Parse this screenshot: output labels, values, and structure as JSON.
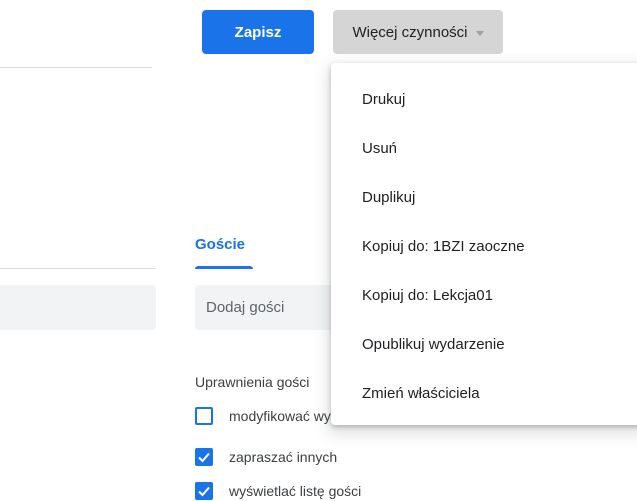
{
  "toolbar": {
    "save_label": "Zapisz",
    "more_actions_label": "Więcej czynności"
  },
  "menu": {
    "items": [
      {
        "label": "Drukuj"
      },
      {
        "label": "Usuń"
      },
      {
        "label": "Duplikuj"
      },
      {
        "label": "Kopiuj do: 1BZI zaoczne"
      },
      {
        "label": "Kopiuj do: Lekcja01"
      },
      {
        "label": "Opublikuj wydarzenie"
      },
      {
        "label": "Zmień właściciela"
      }
    ]
  },
  "guests": {
    "tab_label": "Goście",
    "add_placeholder": "Dodaj gości",
    "permissions_label": "Uprawnienia gości",
    "permissions": [
      {
        "label": "modyfikować wydarzenie",
        "checked": false
      },
      {
        "label": "zapraszać innych",
        "checked": true
      },
      {
        "label": "wyświetlać listę gości",
        "checked": true
      }
    ]
  },
  "colors": {
    "accent": "#1a73e8",
    "secondary_button_bg": "#d5d5d5",
    "input_bg": "#f1f3f4"
  },
  "icons": {
    "dropdown": "caret-down-icon",
    "checkbox_checked": "check-icon"
  }
}
